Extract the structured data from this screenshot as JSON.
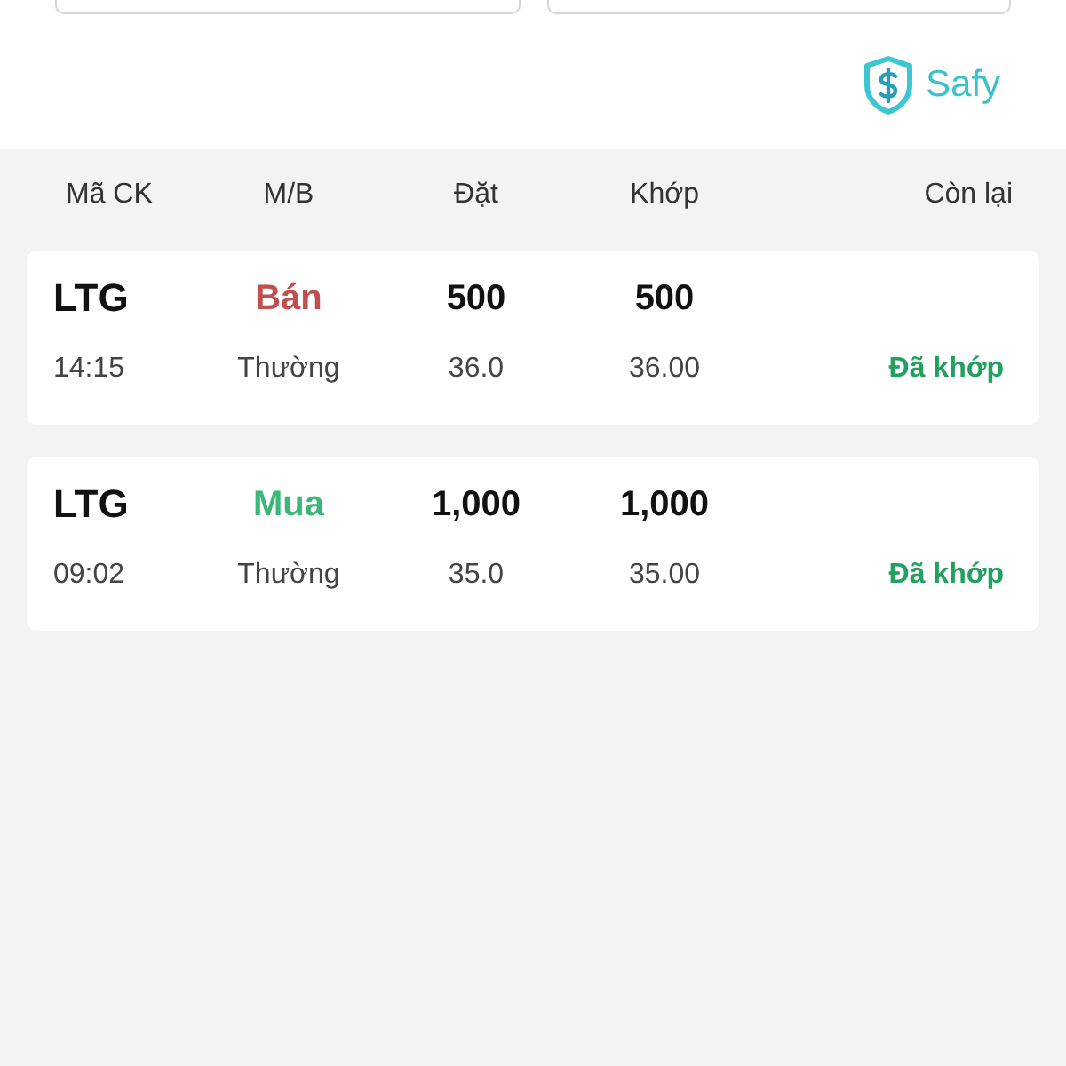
{
  "filters": [
    {
      "kind": "field"
    },
    {
      "kind": "field"
    }
  ],
  "brand": {
    "name": "Safy"
  },
  "table": {
    "columns": [
      "Mã CK",
      "M/B",
      "Đặt",
      "Khớp",
      "Còn lại"
    ],
    "rows": [
      {
        "symbol": "LTG",
        "time": "14:15",
        "side": "Bán",
        "color": "#c0504f",
        "order_type": "Thường",
        "order_qty": "500",
        "order_price": "36.0",
        "match_qty": "500",
        "match_price": "36.00",
        "status": "Đã khớp"
      },
      {
        "symbol": "LTG",
        "time": "09:02",
        "side": "Mua",
        "color": "#3bb77a",
        "order_type": "Thường",
        "order_qty": "1,000",
        "order_price": "35.0",
        "match_qty": "1,000",
        "match_price": "35.00",
        "status": "Đã khớp"
      }
    ]
  }
}
